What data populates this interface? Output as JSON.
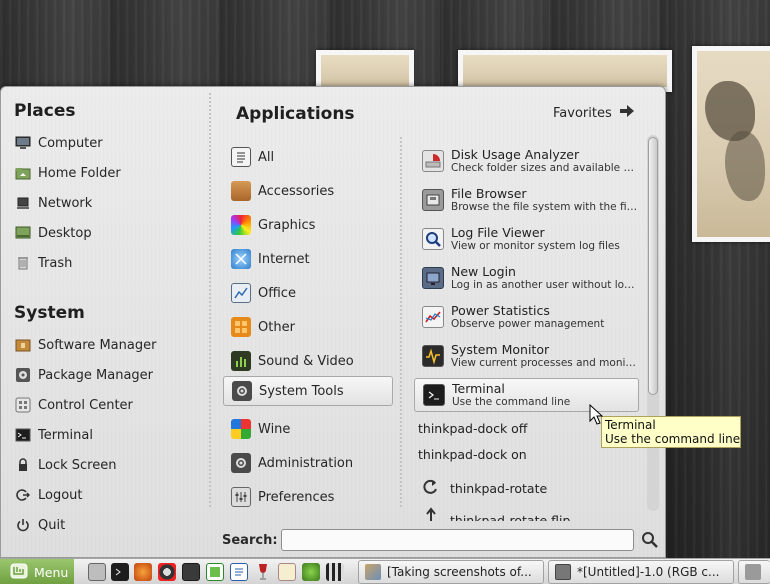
{
  "places": {
    "title": "Places",
    "items": [
      {
        "label": "Computer"
      },
      {
        "label": "Home Folder"
      },
      {
        "label": "Network"
      },
      {
        "label": "Desktop"
      },
      {
        "label": "Trash"
      }
    ]
  },
  "system": {
    "title": "System",
    "items": [
      {
        "label": "Software Manager"
      },
      {
        "label": "Package Manager"
      },
      {
        "label": "Control Center"
      },
      {
        "label": "Terminal"
      },
      {
        "label": "Lock Screen"
      },
      {
        "label": "Logout"
      },
      {
        "label": "Quit"
      }
    ]
  },
  "applications": {
    "title": "Applications",
    "favorites_label": "Favorites",
    "categories": [
      {
        "label": "All"
      },
      {
        "label": "Accessories"
      },
      {
        "label": "Graphics"
      },
      {
        "label": "Internet"
      },
      {
        "label": "Office"
      },
      {
        "label": "Other"
      },
      {
        "label": "Sound & Video"
      },
      {
        "label": "System Tools",
        "selected": true
      },
      {
        "label": "Wine"
      },
      {
        "label": "Administration"
      },
      {
        "label": "Preferences"
      }
    ],
    "apps": [
      {
        "name": "Disk Usage Analyzer",
        "desc": "Check folder sizes and available dis..."
      },
      {
        "name": "File Browser",
        "desc": "Browse the file system with the file ..."
      },
      {
        "name": "Log File Viewer",
        "desc": "View or monitor system log files"
      },
      {
        "name": "New Login",
        "desc": "Log in as another user without loggi..."
      },
      {
        "name": "Power Statistics",
        "desc": "Observe power management"
      },
      {
        "name": "System Monitor",
        "desc": "View current processes and monito..."
      },
      {
        "name": "Terminal",
        "desc": "Use the command line",
        "selected": true
      }
    ],
    "plain_apps": [
      "thinkpad-dock off",
      "thinkpad-dock on"
    ],
    "icon_apps": [
      "thinkpad-rotate",
      "thinkpad-rotate flip"
    ]
  },
  "search": {
    "label": "Search:",
    "value": ""
  },
  "tooltip": {
    "line1": "Terminal",
    "line2": "Use the command line"
  },
  "taskbar": {
    "menu_label": "Menu",
    "windows": [
      {
        "label": "[Taking screenshots of..."
      },
      {
        "label": "*[Untitled]-1.0 (RGB c..."
      }
    ]
  }
}
